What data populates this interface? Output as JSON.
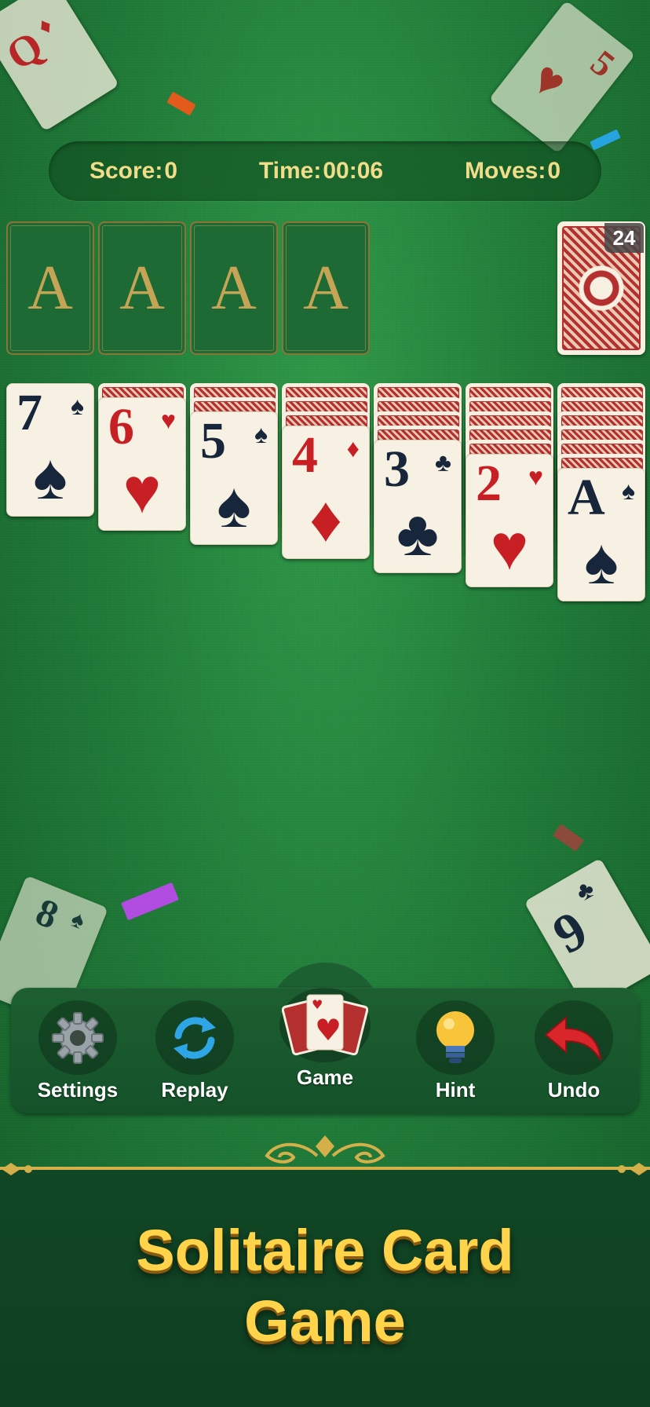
{
  "status_bar": {
    "score_label": "Score:",
    "score_value": "0",
    "time_label": "Time:",
    "time_value": "00:06",
    "moves_label": "Moves:",
    "moves_value": "0"
  },
  "foundations": [
    {
      "label": "A"
    },
    {
      "label": "A"
    },
    {
      "label": "A"
    },
    {
      "label": "A"
    }
  ],
  "stock": {
    "count": "24"
  },
  "tableau": [
    {
      "facedown": 0,
      "rank": "7",
      "suit": "♠",
      "color": "black"
    },
    {
      "facedown": 1,
      "rank": "6",
      "suit": "♥",
      "color": "red"
    },
    {
      "facedown": 2,
      "rank": "5",
      "suit": "♠",
      "color": "black"
    },
    {
      "facedown": 3,
      "rank": "4",
      "suit": "♦",
      "color": "red"
    },
    {
      "facedown": 4,
      "rank": "3",
      "suit": "♣",
      "color": "black"
    },
    {
      "facedown": 5,
      "rank": "2",
      "suit": "♥",
      "color": "red"
    },
    {
      "facedown": 6,
      "rank": "A",
      "suit": "♠",
      "color": "black"
    }
  ],
  "toolbar": {
    "settings_label": "Settings",
    "replay_label": "Replay",
    "game_label": "Game",
    "hint_label": "Hint",
    "undo_label": "Undo"
  },
  "decor_cards": {
    "top_left": {
      "rank": "Q",
      "suit": "♦"
    },
    "top_right": {
      "rank": "5",
      "suit": "♥"
    },
    "bottom_left": {
      "rank": "8",
      "suit": "♠"
    },
    "bottom_right": {
      "rank": "9",
      "suit": "♣"
    }
  },
  "banner": {
    "title_line1": "Solitaire Card",
    "title_line2": "Game"
  },
  "colors": {
    "felt": "#217d39",
    "gold_text": "#f1dc8a",
    "title_gold": "#ffd44a",
    "card_red": "#c81f25",
    "card_black": "#17263a"
  }
}
